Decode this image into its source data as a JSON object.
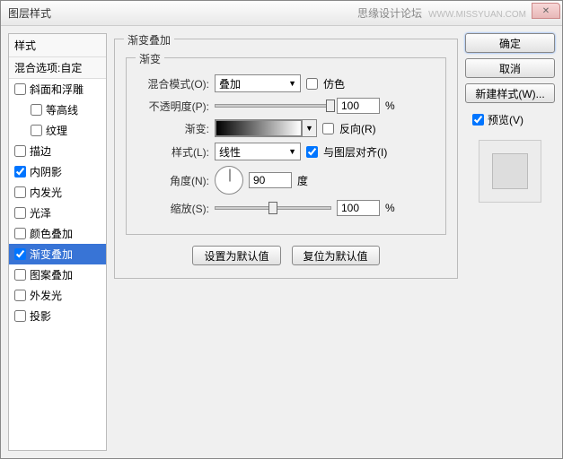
{
  "titlebar": {
    "title": "图层样式",
    "watermark": "思缘设计论坛",
    "url": "WWW.MISSYUAN.COM"
  },
  "sidebar": {
    "header": "样式",
    "sub": "混合选项:自定",
    "items": [
      {
        "label": "斜面和浮雕",
        "checked": false,
        "indent": false
      },
      {
        "label": "等高线",
        "checked": false,
        "indent": true
      },
      {
        "label": "纹理",
        "checked": false,
        "indent": true
      },
      {
        "label": "描边",
        "checked": false,
        "indent": false
      },
      {
        "label": "内阴影",
        "checked": true,
        "indent": false
      },
      {
        "label": "内发光",
        "checked": false,
        "indent": false
      },
      {
        "label": "光泽",
        "checked": false,
        "indent": false
      },
      {
        "label": "颜色叠加",
        "checked": false,
        "indent": false
      },
      {
        "label": "渐变叠加",
        "checked": true,
        "indent": false,
        "selected": true
      },
      {
        "label": "图案叠加",
        "checked": false,
        "indent": false
      },
      {
        "label": "外发光",
        "checked": false,
        "indent": false
      },
      {
        "label": "投影",
        "checked": false,
        "indent": false
      }
    ]
  },
  "main": {
    "group_title": "渐变叠加",
    "inner_title": "渐变",
    "blend_label": "混合模式(O):",
    "blend_value": "叠加",
    "dither_label": "仿色",
    "opacity_label": "不透明度(P):",
    "opacity_value": "100",
    "percent": "%",
    "gradient_label": "渐变:",
    "reverse_label": "反向(R)",
    "style_label": "样式(L):",
    "style_value": "线性",
    "align_label": "与图层对齐(I)",
    "angle_label": "角度(N):",
    "angle_value": "90",
    "degree": "度",
    "scale_label": "缩放(S):",
    "scale_value": "100",
    "set_default": "设置为默认值",
    "reset_default": "复位为默认值"
  },
  "right": {
    "ok": "确定",
    "cancel": "取消",
    "new_style": "新建样式(W)...",
    "preview": "预览(V)"
  }
}
